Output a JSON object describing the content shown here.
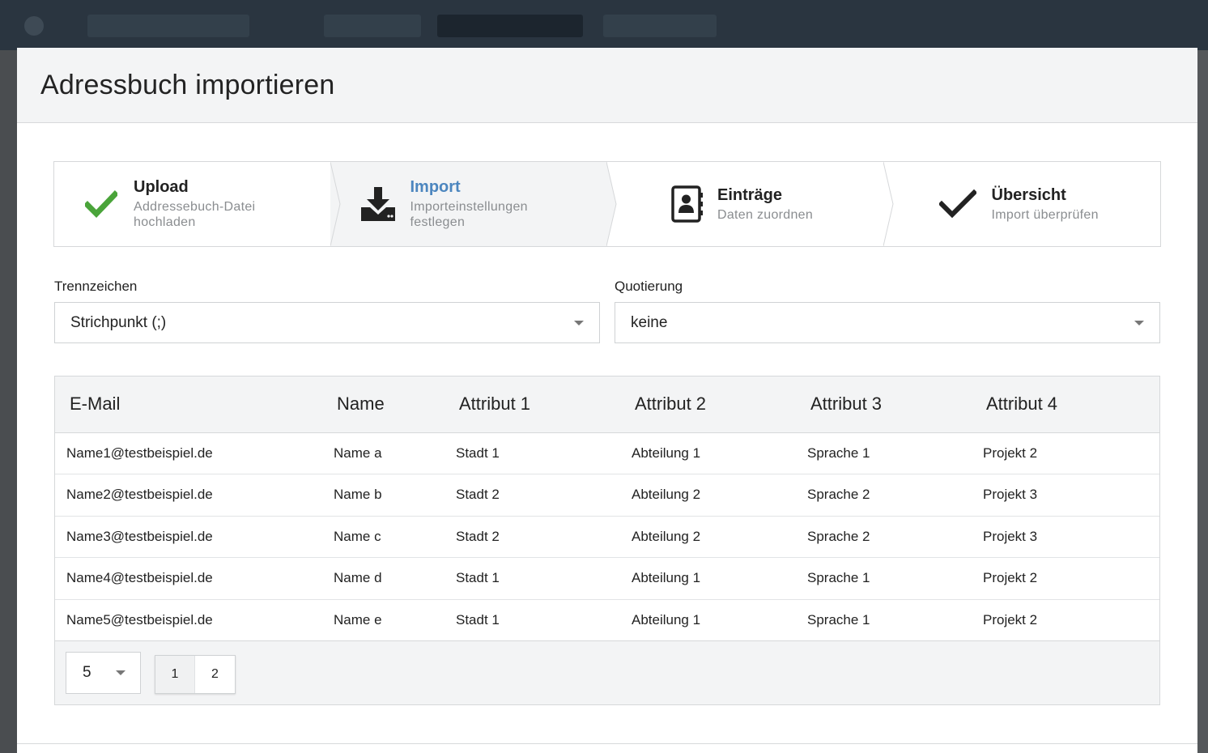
{
  "modal": {
    "title": "Adressbuch importieren"
  },
  "stepper": {
    "steps": [
      {
        "title": "Upload",
        "subtitle_line1": "Addressebuch-Datei",
        "subtitle_line2": "hochladen",
        "icon": "check-icon",
        "state": "done"
      },
      {
        "title": "Import",
        "subtitle_line1": "Importeinstellungen",
        "subtitle_line2": "festlegen",
        "icon": "download-tray-icon",
        "state": "active"
      },
      {
        "title": "Einträge",
        "subtitle_line1": "Daten zuordnen",
        "icon": "contact-book-icon",
        "state": "pending"
      },
      {
        "title": "Übersicht",
        "subtitle_line1": "Import überprüfen",
        "icon": "checkmark-icon",
        "state": "pending"
      }
    ]
  },
  "settings": {
    "separator_label": "Trennzeichen",
    "separator_value": "Strichpunkt (;)",
    "quoting_label": "Quotierung",
    "quoting_value": "keine"
  },
  "table": {
    "headers": [
      "E-Mail",
      "Name",
      "Attribut 1",
      "Attribut 2",
      "Attribut 3",
      "Attribut 4"
    ],
    "rows": [
      [
        "Name1@testbeispiel.de",
        "Name a",
        "Stadt 1",
        "Abteilung 1",
        "Sprache 1",
        "Projekt 2"
      ],
      [
        "Name2@testbeispiel.de",
        "Name b",
        "Stadt 2",
        "Abteilung 2",
        "Sprache 2",
        "Projekt 3"
      ],
      [
        "Name3@testbeispiel.de",
        "Name c",
        "Stadt 2",
        "Abteilung 2",
        "Sprache 2",
        "Projekt 3"
      ],
      [
        "Name4@testbeispiel.de",
        "Name d",
        "Stadt 1",
        "Abteilung 1",
        "Sprache 1",
        "Projekt 2"
      ],
      [
        "Name5@testbeispiel.de",
        "Name e",
        "Stadt 1",
        "Abteilung 1",
        "Sprache 1",
        "Projekt 2"
      ]
    ]
  },
  "pagination": {
    "page_size": "5",
    "pages": [
      "1",
      "2"
    ],
    "current_page": "1"
  },
  "colors": {
    "accent_blue": "#4c86bf",
    "success_green": "#4aa43a",
    "header_bg": "#f3f4f5"
  }
}
